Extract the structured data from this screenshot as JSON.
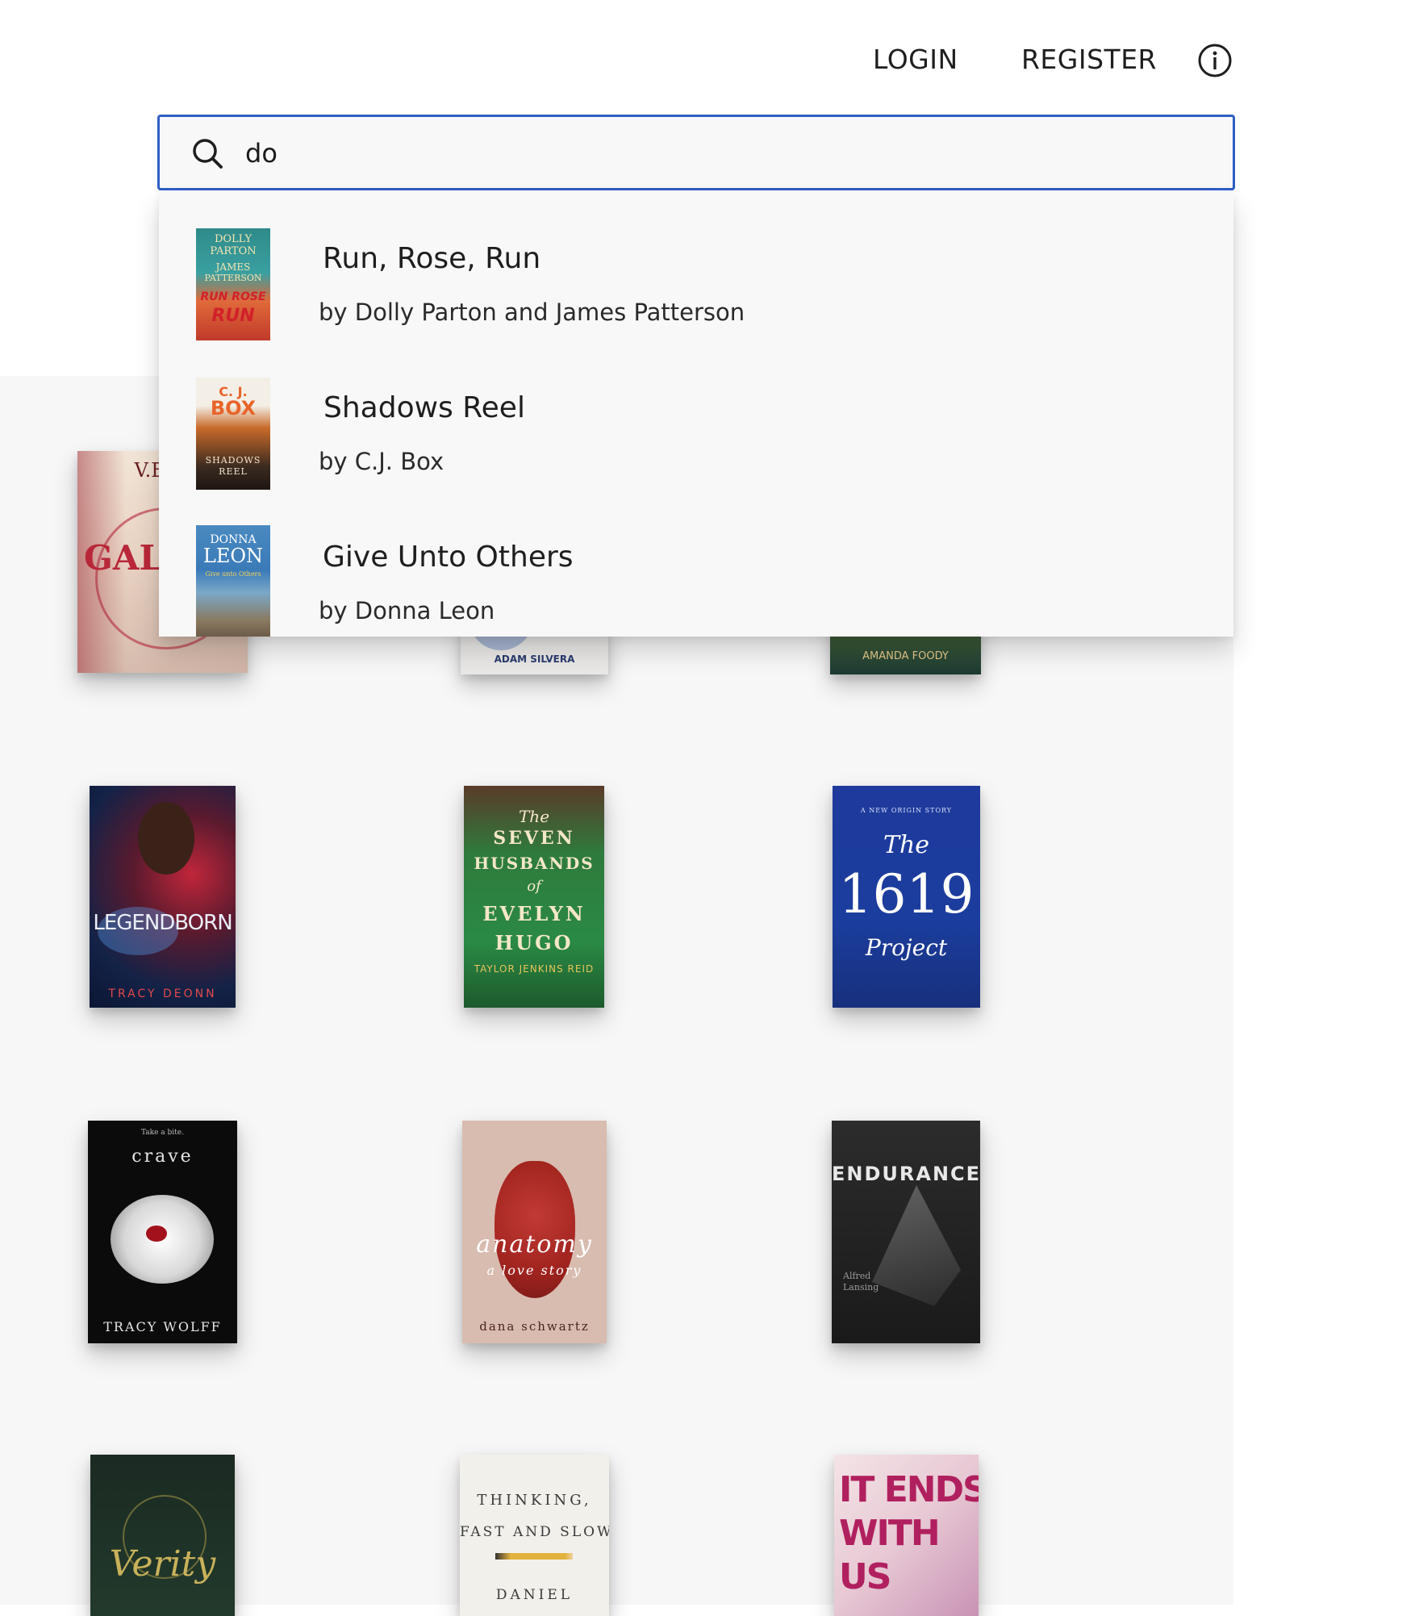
{
  "header": {
    "login": "LOGIN",
    "register": "REGISTER",
    "info_icon": "info-circle-icon"
  },
  "search": {
    "value": "do",
    "icon": "search-icon"
  },
  "suggestions": [
    {
      "title": "Run, Rose, Run",
      "author": "by Dolly Parton and James Patterson",
      "cover": {
        "line1": "DOLLY",
        "line2": "PARTON",
        "line3": "JAMES",
        "line4": "PATTERSON",
        "line5": "RUN ROSE",
        "line6": "RUN"
      }
    },
    {
      "title": "Shadows Reel",
      "author": "by C.J. Box",
      "cover": {
        "line1": "C. J.",
        "line2": "BOX",
        "line3": "SHADOWS",
        "line4": "REEL"
      }
    },
    {
      "title": "Give Unto Others",
      "author": "by Donna Leon",
      "cover": {
        "line1": "DONNA",
        "line2": "LEON",
        "line3": "Give unto Others"
      }
    }
  ],
  "books": [
    {
      "cover_text": [
        "V.E. S",
        "GAL"
      ]
    },
    {
      "cover_text": [
        "ADAM SILVERA"
      ]
    },
    {
      "cover_text": [
        "AMANDA FOODY"
      ]
    },
    {
      "cover_text": [
        "LEGENDBORN",
        "TRACY DEONN"
      ]
    },
    {
      "cover_text": [
        "The",
        "SEVEN",
        "HUSBANDS",
        "of",
        "EVELYN",
        "HUGO",
        "TAYLOR JENKINS REID"
      ]
    },
    {
      "cover_text": [
        "A NEW ORIGIN STORY",
        "The",
        "1619",
        "Project"
      ]
    },
    {
      "cover_text": [
        "Take a bite.",
        "crave",
        "TRACY WOLFF"
      ]
    },
    {
      "cover_text": [
        "anatomy",
        "a love story",
        "dana schwartz"
      ]
    },
    {
      "cover_text": [
        "ENDURANCE",
        "Alfred",
        "Lansing"
      ]
    },
    {
      "cover_text": [
        "Verity"
      ]
    },
    {
      "cover_text": [
        "THINKING,",
        "FAST AND SLOW",
        "DANIEL"
      ]
    },
    {
      "cover_text": [
        "IT ENDS",
        "WITH",
        "US"
      ]
    }
  ],
  "colors": {
    "accent": "#2f5fc4",
    "panel_bg": "#f7f7f7",
    "dropdown_bg": "#f8f8f8"
  }
}
